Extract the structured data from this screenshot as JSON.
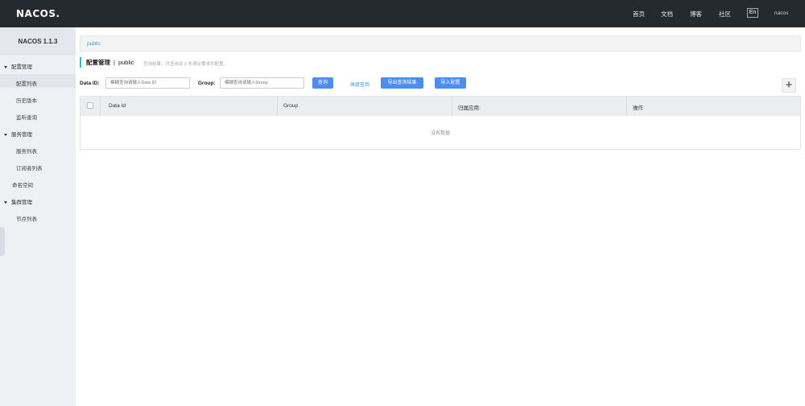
{
  "topbar": {
    "logo": "NACOS.",
    "nav": [
      "首页",
      "文档",
      "博客",
      "社区"
    ],
    "lang": "En",
    "user": "nacos"
  },
  "sidebar": {
    "title": "NACOS 1.1.3",
    "items": [
      {
        "label": "配置管理",
        "type": "group"
      },
      {
        "label": "配置列表",
        "type": "sub"
      },
      {
        "label": "历史版本",
        "type": "sub"
      },
      {
        "label": "监听查询",
        "type": "sub"
      },
      {
        "label": "服务管理",
        "type": "group"
      },
      {
        "label": "服务列表",
        "type": "sub"
      },
      {
        "label": "订阅者列表",
        "type": "sub"
      },
      {
        "label": "命名空间",
        "type": "plain"
      },
      {
        "label": "集群管理",
        "type": "group"
      },
      {
        "label": "节点列表",
        "type": "sub"
      }
    ]
  },
  "breadcrumb": "public",
  "heading": {
    "title": "配置管理",
    "separator": "|",
    "namespace": "public",
    "result_hint": "查询结果：共查询到 0 条满足要求的配置。"
  },
  "search": {
    "dataid_label": "Data ID:",
    "dataid_placeholder": "模糊查询请输入Data ID",
    "group_label": "Group:",
    "group_placeholder": "模糊查询请输入Group",
    "query_button": "查询",
    "advanced_link": "高级查询",
    "export_button": "导出查询结果",
    "import_button": "导入配置"
  },
  "table": {
    "columns": [
      "Data Id",
      "Group",
      "归属应用:",
      "操作"
    ],
    "empty_text": "没有数据"
  },
  "colors": {
    "topbar": "#252a2f",
    "accent": "#4b8ef0",
    "link": "#3b9bd6"
  }
}
